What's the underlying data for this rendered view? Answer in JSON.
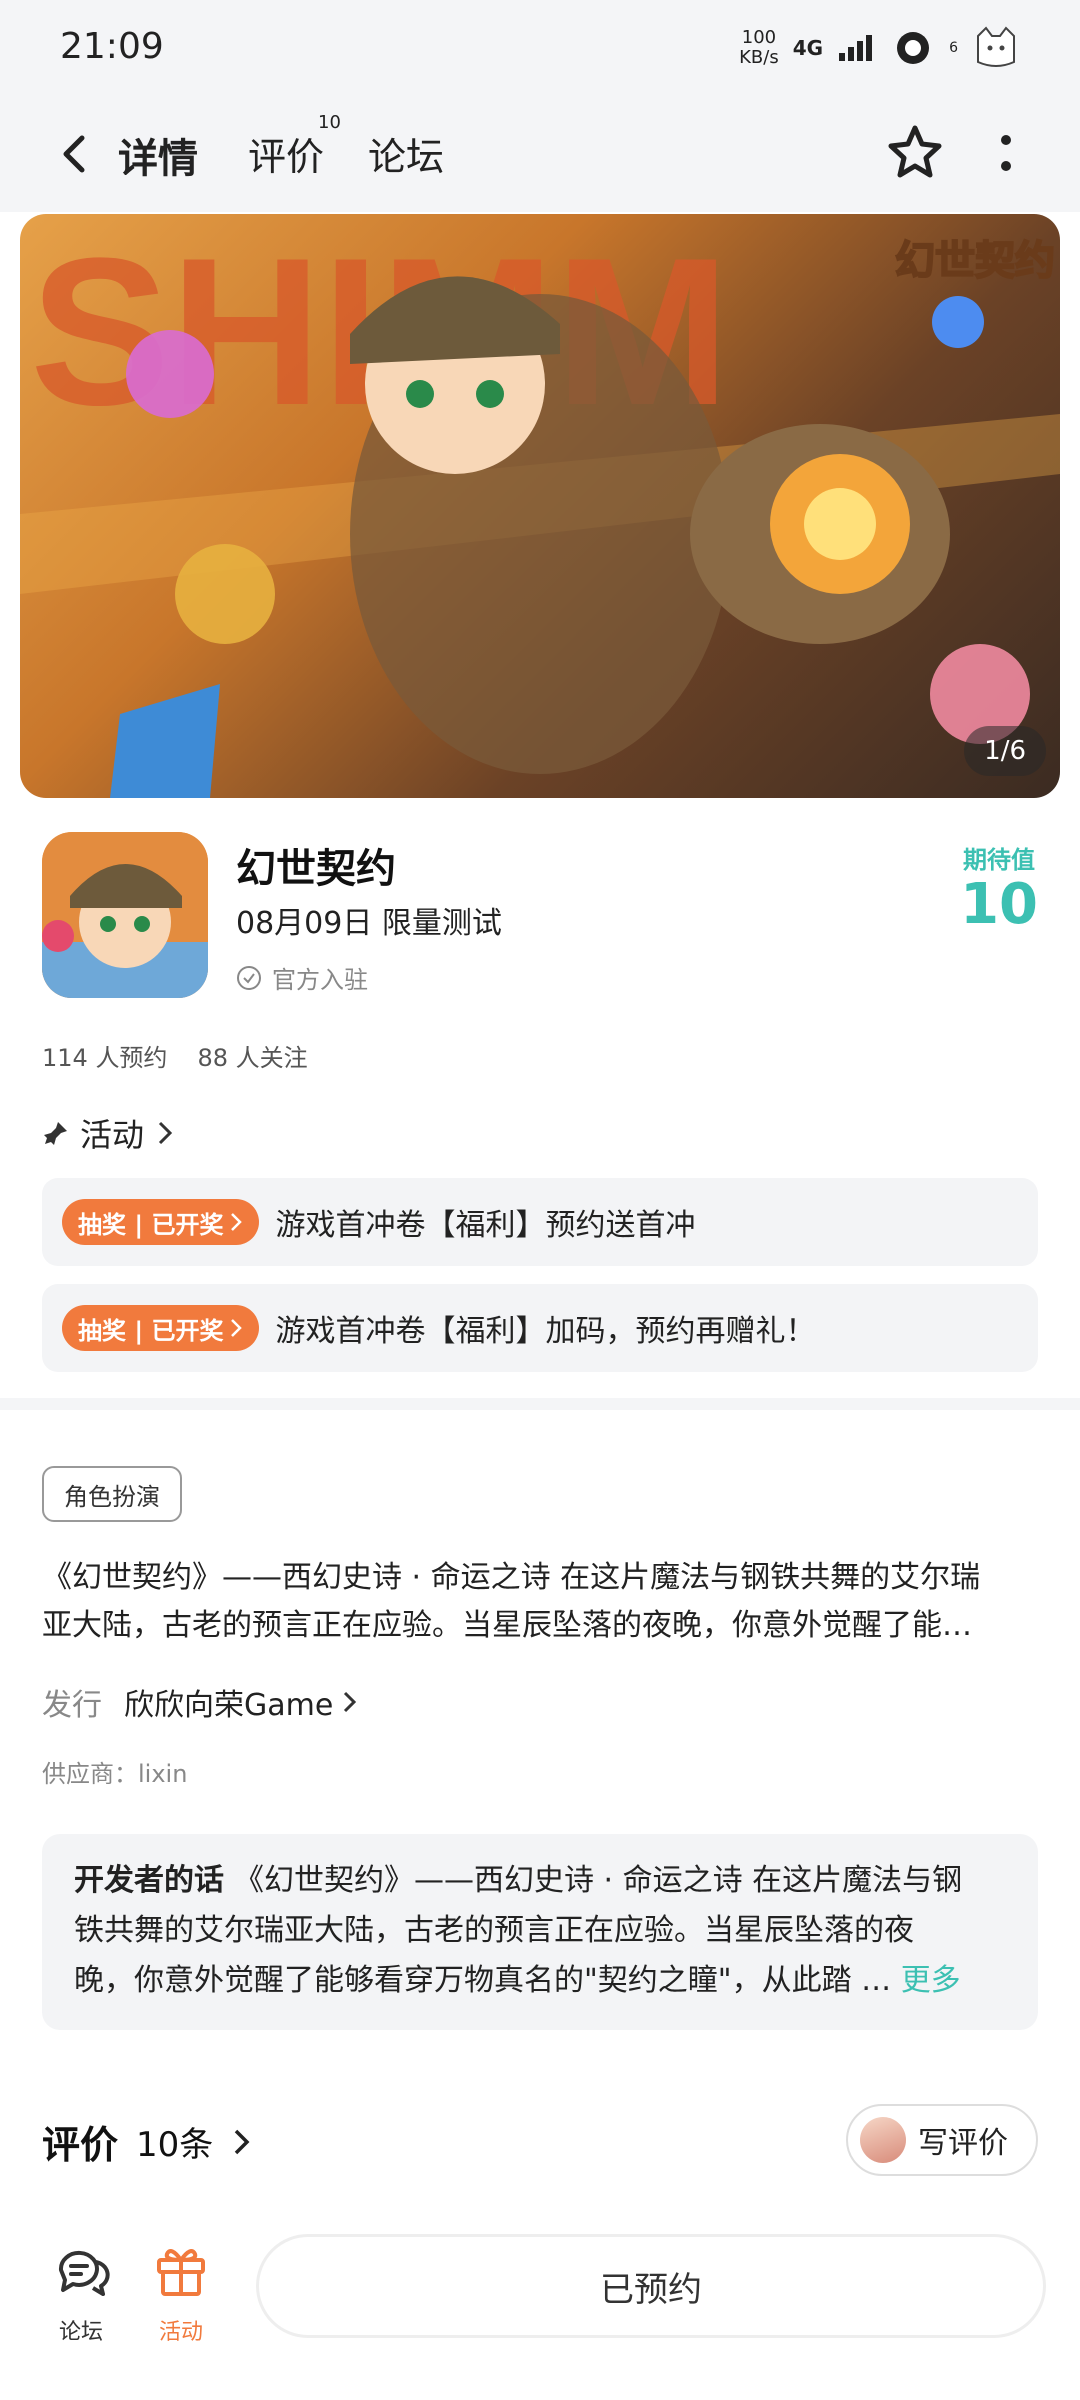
{
  "status_bar": {
    "time": "21:09",
    "net_speed_value": "100",
    "net_speed_unit": "KB/s",
    "network": "4G",
    "sim_index": "6"
  },
  "nav": {
    "tabs": [
      {
        "label": "详情",
        "active": true
      },
      {
        "label": "评价",
        "badge": "10"
      },
      {
        "label": "论坛"
      }
    ]
  },
  "banner": {
    "page_indicator": "1/6",
    "logo_text": "幻世契约"
  },
  "game": {
    "name": "幻世契约",
    "date_text": "08月09日 限量测试",
    "official_label": "官方入驻",
    "expect_label": "期待值",
    "expect_value": "10",
    "reservations": "114 人预约",
    "followers": "88 人关注"
  },
  "activity": {
    "header": "活动",
    "items": [
      {
        "badge": "抽奖 | 已开奖",
        "text": "游戏首冲卷【福利】预约送首冲"
      },
      {
        "badge": "抽奖 | 已开奖",
        "text": "游戏首冲卷【福利】加码，预约再赠礼！"
      }
    ]
  },
  "details": {
    "genre_tag": "角色扮演",
    "description_line1": "《幻世契约》——西幻史诗 · 命运之诗 在这片魔法与钢铁共舞的艾尔瑞",
    "description_line2": "亚大陆，古老的预言正在应验。当星辰坠落的夜晚，你意外觉醒了能…",
    "publisher_label": "发行",
    "publisher_name": "欣欣向荣Game",
    "supplier": "供应商：lixin"
  },
  "developer_note": {
    "label": "开发者的话",
    "line1": "《幻世契约》——西幻史诗 · 命运之诗 在这片魔法与钢",
    "line2": "铁共舞的艾尔瑞亚大陆，古老的预言正在应验。当星辰坠落的夜",
    "line3": "晚，你意外觉醒了能够看穿万物真名的\"契约之瞳\"，从此踏 …",
    "more": "更多"
  },
  "reviews": {
    "title": "评价",
    "count": "10条",
    "write_label": "写评价"
  },
  "bottom": {
    "forum_label": "论坛",
    "activity_label": "活动",
    "reserve_label": "已预约"
  },
  "colors": {
    "accent_teal": "#3cc0b2",
    "accent_orange": "#f17a3d"
  }
}
